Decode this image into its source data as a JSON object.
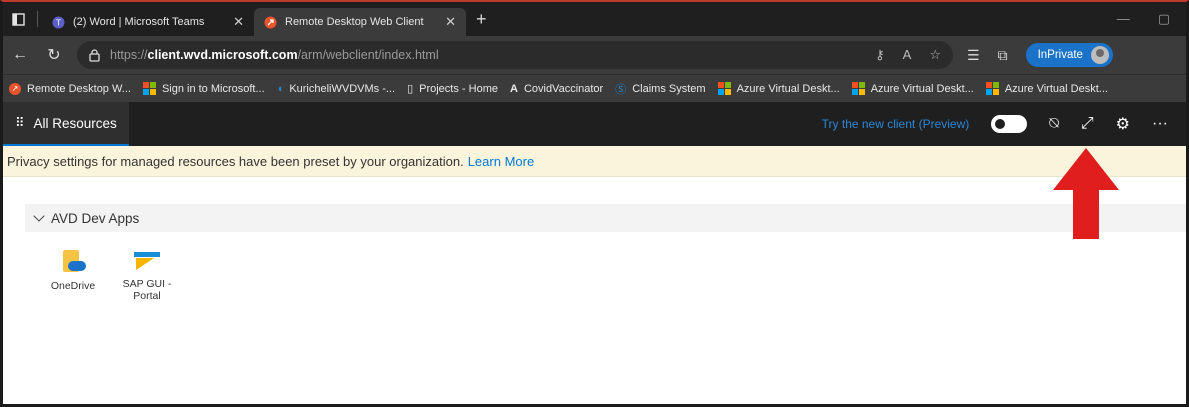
{
  "browser": {
    "tabs": [
      {
        "title": "(2) Word | Microsoft Teams",
        "icon": "teams-icon"
      },
      {
        "title": "Remote Desktop Web Client",
        "icon": "remote-desktop-icon"
      }
    ],
    "url": {
      "scheme": "https://",
      "host": "client.wvd.microsoft.com",
      "path": "/arm/webclient/index.html"
    },
    "inprivate_label": "InPrivate"
  },
  "bookmarks": [
    {
      "label": "Remote Desktop W...",
      "icon": "remote-desktop-icon"
    },
    {
      "label": "Sign in to Microsoft...",
      "icon": "microsoft-icon"
    },
    {
      "label": "KuricheliWVDVMs -...",
      "icon": "devops-icon"
    },
    {
      "label": "Projects - Home",
      "icon": "page-icon"
    },
    {
      "label": "CovidVaccinator",
      "icon": "a-icon"
    },
    {
      "label": "Claims System",
      "icon": "s-icon"
    },
    {
      "label": "Azure Virtual Deskt...",
      "icon": "microsoft-icon"
    },
    {
      "label": "Azure Virtual Deskt...",
      "icon": "microsoft-icon"
    },
    {
      "label": "Azure Virtual Deskt...",
      "icon": "microsoft-icon"
    }
  ],
  "app": {
    "all_resources_label": "All Resources",
    "try_new_client_label": "Try the new client (Preview)",
    "privacy_text": "Privacy settings for managed resources have been preset by your organization.",
    "learn_more_label": "Learn More",
    "group_label": "AVD Dev Apps",
    "apps": [
      {
        "label": "OneDrive",
        "icon": "onedrive-icon"
      },
      {
        "label": "SAP GUI - Portal",
        "icon": "sap-gui-icon"
      }
    ]
  },
  "colors": {
    "accent": "#0078d4",
    "inprivate": "#1a73c9",
    "annotation_arrow": "#e01e1e",
    "privacy_bar": "#fbf4dc"
  }
}
